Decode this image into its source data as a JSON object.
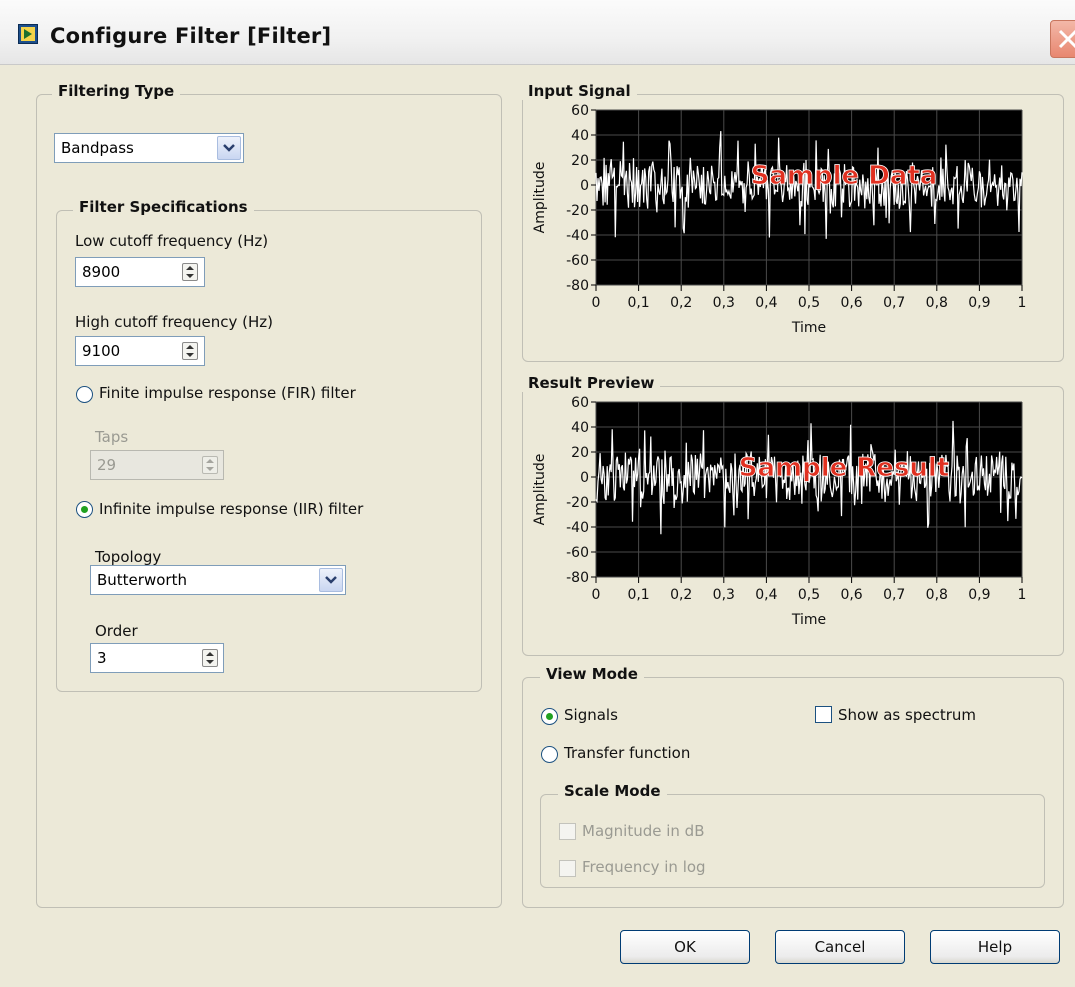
{
  "window": {
    "title": "Configure Filter [Filter]"
  },
  "filtering_type": {
    "title": "Filtering Type",
    "selected": "Bandpass"
  },
  "filter_specifications": {
    "title": "Filter Specifications",
    "low_cutoff_label": "Low cutoff frequency (Hz)",
    "low_cutoff_value": "8900",
    "high_cutoff_label": "High cutoff frequency (Hz)",
    "high_cutoff_value": "9100",
    "fir_label": "Finite impulse response (FIR) filter",
    "taps_label": "Taps",
    "taps_value": "29",
    "iir_label": "Infinite impulse response (IIR) filter",
    "topology_label": "Topology",
    "topology_value": "Butterworth",
    "order_label": "Order",
    "order_value": "3",
    "selected_type": "IIR"
  },
  "input_signal": {
    "title": "Input Signal",
    "overlay": "Sample Data",
    "ylabel": "Amplitude",
    "xlabel": "Time",
    "yticks": [
      "60",
      "40",
      "20",
      "0",
      "-20",
      "-40",
      "-60",
      "-80"
    ],
    "xticks": [
      "0",
      "0,1",
      "0,2",
      "0,3",
      "0,4",
      "0,5",
      "0,6",
      "0,7",
      "0,8",
      "0,9",
      "1"
    ]
  },
  "result_preview": {
    "title": "Result Preview",
    "overlay": "Sample Result",
    "ylabel": "Amplitude",
    "xlabel": "Time",
    "yticks": [
      "60",
      "40",
      "20",
      "0",
      "-20",
      "-40",
      "-60",
      "-80"
    ],
    "xticks": [
      "0",
      "0,1",
      "0,2",
      "0,3",
      "0,4",
      "0,5",
      "0,6",
      "0,7",
      "0,8",
      "0,9",
      "1"
    ]
  },
  "view_mode": {
    "title": "View Mode",
    "signals_label": "Signals",
    "transfer_label": "Transfer function",
    "spectrum_label": "Show as spectrum",
    "selected": "Signals",
    "show_as_spectrum": false
  },
  "scale_mode": {
    "title": "Scale Mode",
    "magnitude_label": "Magnitude in dB",
    "frequency_label": "Frequency in log"
  },
  "buttons": {
    "ok": "OK",
    "cancel": "Cancel",
    "help": "Help"
  },
  "colors": {
    "window_bg": "#ece9d8",
    "plot_bg": "#000000",
    "plot_trace": "#ffffff",
    "overlay_text": "#e03020",
    "radio_dot": "#21a121"
  },
  "chart_data": [
    {
      "type": "line",
      "name": "input_signal",
      "xlim": [
        0,
        1
      ],
      "ylim": [
        -80,
        60
      ],
      "x_ticks": [
        0,
        0.1,
        0.2,
        0.3,
        0.4,
        0.5,
        0.6,
        0.7,
        0.8,
        0.9,
        1
      ],
      "y_ticks": [
        60,
        40,
        20,
        0,
        -20,
        -40,
        -60,
        -80
      ],
      "grid": true,
      "signal": "noise around 0, typical range -20 to 20, peaks to about +/-45"
    },
    {
      "type": "line",
      "name": "result_preview",
      "xlim": [
        0,
        1
      ],
      "ylim": [
        -80,
        60
      ],
      "x_ticks": [
        0,
        0.1,
        0.2,
        0.3,
        0.4,
        0.5,
        0.6,
        0.7,
        0.8,
        0.9,
        1
      ],
      "y_ticks": [
        60,
        40,
        20,
        0,
        -20,
        -40,
        -60,
        -80
      ],
      "grid": true,
      "signal": "noise around 0, typical range -20 to 20, peaks to about +/-45"
    }
  ]
}
